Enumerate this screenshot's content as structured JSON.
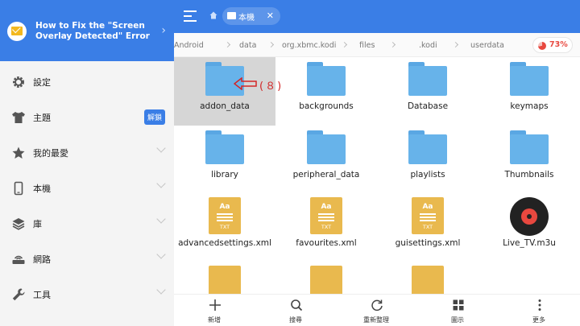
{
  "sidebar": {
    "header_title": "How to Fix the \"Screen Overlay Detected\" Error",
    "items": [
      {
        "label": "設定"
      },
      {
        "label": "主題",
        "badge": "解鎖"
      },
      {
        "label": "我的最愛"
      },
      {
        "label": "本機"
      },
      {
        "label": "庫"
      },
      {
        "label": "網路"
      },
      {
        "label": "工具"
      }
    ]
  },
  "topbar": {
    "tab_label": "本機",
    "tab_close": "✕"
  },
  "breadcrumb": [
    "Android",
    "data",
    "org.xbmc.kodi",
    "files",
    ".kodi",
    "userdata"
  ],
  "storage": {
    "percent": "73%",
    "fill_fraction": 0.73,
    "color": "#e8483f"
  },
  "annotation": {
    "text": "(８)",
    "color": "#d32626"
  },
  "files": [
    {
      "name": "addon_data",
      "type": "folder"
    },
    {
      "name": "backgrounds",
      "type": "folder"
    },
    {
      "name": "Database",
      "type": "folder"
    },
    {
      "name": "keymaps",
      "type": "folder"
    },
    {
      "name": "library",
      "type": "folder"
    },
    {
      "name": "peripheral_data",
      "type": "folder"
    },
    {
      "name": "playlists",
      "type": "folder"
    },
    {
      "name": "Thumbnails",
      "type": "folder"
    },
    {
      "name": "advancedsettings.xml",
      "type": "txt",
      "badge": "Aa",
      "ext": "TXT"
    },
    {
      "name": "favourites.xml",
      "type": "txt",
      "badge": "Aa",
      "ext": "TXT"
    },
    {
      "name": "guisettings.xml",
      "type": "txt",
      "badge": "Aa",
      "ext": "TXT"
    },
    {
      "name": "Live_TV.m3u",
      "type": "audio"
    }
  ],
  "bottombar": [
    {
      "label": "新增",
      "icon": "plus-icon"
    },
    {
      "label": "搜尋",
      "icon": "search-icon"
    },
    {
      "label": "重新整理",
      "icon": "refresh-icon"
    },
    {
      "label": "圖示",
      "icon": "grid-view-icon"
    },
    {
      "label": "更多",
      "icon": "more-icon"
    }
  ],
  "colors": {
    "accent": "#3a7ee6",
    "folder": "#67b3ea",
    "txt": "#e9b94e"
  }
}
